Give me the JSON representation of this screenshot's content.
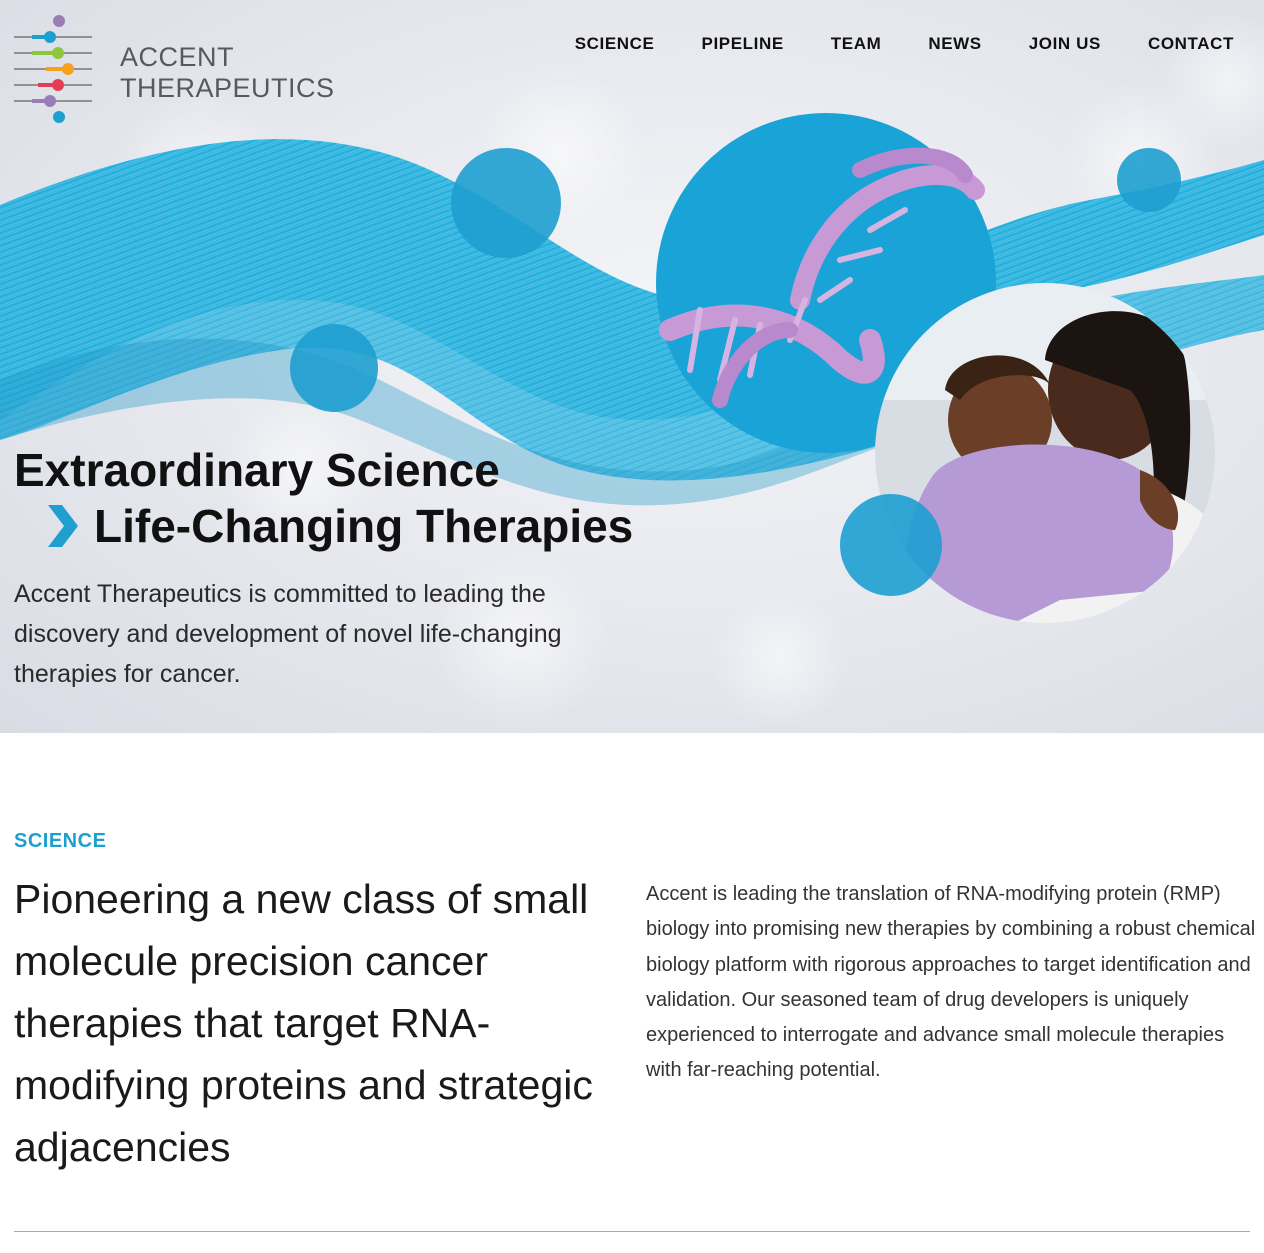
{
  "brand": {
    "name_line1": "ACCENT",
    "name_line2": "THERAPEUTICS",
    "colors": {
      "accent": "#1e9fd0",
      "purple": "#9b7db6",
      "green": "#8dc63f",
      "orange": "#f7a11a",
      "red": "#e63c55"
    }
  },
  "nav": {
    "items": [
      {
        "label": "SCIENCE"
      },
      {
        "label": "PIPELINE"
      },
      {
        "label": "TEAM"
      },
      {
        "label": "NEWS"
      },
      {
        "label": "JOIN US"
      },
      {
        "label": "CONTACT"
      }
    ]
  },
  "hero": {
    "headline_line1": "Extraordinary Science",
    "headline_line2": "Life-Changing Therapies",
    "description": "Accent Therapeutics is committed to leading the discovery and development of novel life-changing therapies for cancer."
  },
  "science": {
    "label": "SCIENCE",
    "title": "Pioneering a new class of small molecule precision cancer therapies that target RNA-modifying proteins and strategic adjacencies",
    "description": "Accent is leading the translation of RNA-modifying protein (RMP) biology into promising new therapies by combining a robust chemical biology platform with rigorous approaches to target identification and validation. Our seasoned team of drug developers is uniquely experienced to interrogate and advance small molecule therapies with far-reaching potential."
  },
  "icons": [
    "logo-mark-icon",
    "chevron-right-icon",
    "dna-helix-icon"
  ]
}
